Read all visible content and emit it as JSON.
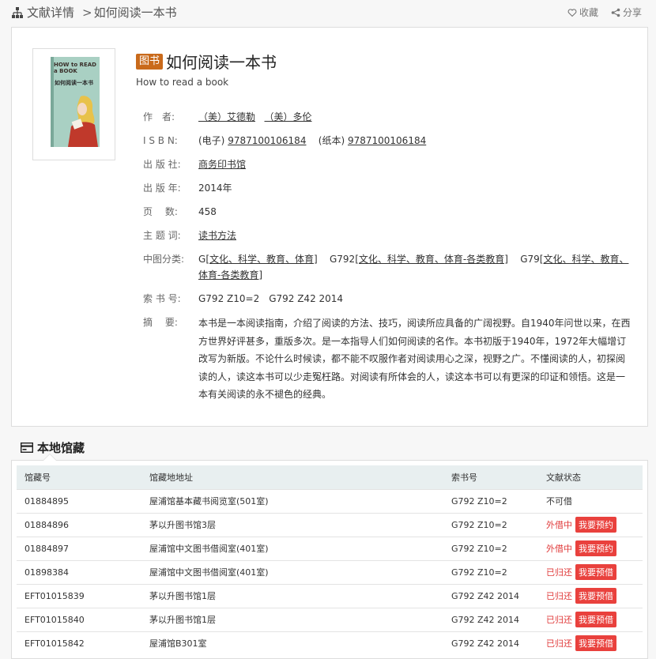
{
  "breadcrumb": {
    "section": "文献详情",
    "separator": ">",
    "current": "如何阅读一本书"
  },
  "actions": {
    "favorite": "收藏",
    "share": "分享"
  },
  "book": {
    "type_badge": "图书",
    "title": "如何阅读一本书",
    "subtitle": "How to read a book",
    "cover": {
      "text_en": "HOW to READ a BOOK",
      "text_cn": "如何阅读一本书"
    },
    "fields": {
      "author_label": "作　者:",
      "authors": [
        "（美）艾德勒",
        "（美）多伦"
      ],
      "isbn_label": "I S B N:",
      "isbn_e_prefix": "(电子)",
      "isbn_e": "9787100106184",
      "isbn_p_prefix": "(纸本)",
      "isbn_p": "9787100106184",
      "publisher_label": "出 版 社:",
      "publisher": "商务印书馆",
      "year_label": "出 版 年:",
      "year": "2014年",
      "pages_label": "页　 数:",
      "pages": "458",
      "subject_label": "主 题 词:",
      "subject": "读书方法",
      "clc_label": "中图分类:",
      "clc_1_code": "G",
      "clc_1_name": "[文化、科学、教育、体育]",
      "clc_2_code": "G792",
      "clc_2_name": "[文化、科学、教育、体育-各类教育]",
      "clc_3_code": "G79",
      "clc_3_name": "[文化、科学、教育、体育-各类教育]",
      "callno_label": "索 书 号:",
      "callno": "G792 Z10=2　G792 Z42 2014",
      "abstract_label": "摘　 要:",
      "abstract": "本书是一本阅读指南，介绍了阅读的方法、技巧，阅读所应具备的广阔视野。自1940年问世以来，在西方世界好评甚多，重版多次。是一本指导人们如何阅读的名作。本书初版于1940年，1972年大幅增订改写为新版。不论什么时候读，都不能不叹服作者对阅读用心之深，视野之广。不懂阅读的人，初探阅读的人，读这本书可以少走冤枉路。对阅读有所体会的人，读这本书可以有更深的印证和领悟。这是一本有关阅读的永不褪色的经典。"
    }
  },
  "holdings": {
    "title": "本地馆藏",
    "columns": [
      "馆藏号",
      "馆藏地地址",
      "索书号",
      "文献状态"
    ],
    "rows": [
      {
        "id": "01884895",
        "location": "屋浦馆基本藏书阅览室(501室)",
        "callno": "G792 Z10=2",
        "status": "不可借",
        "action": ""
      },
      {
        "id": "01884896",
        "location": "茅以升图书馆3层",
        "callno": "G792 Z10=2",
        "status": "外借中",
        "action": "我要预约"
      },
      {
        "id": "01884897",
        "location": "屋浦馆中文图书借阅室(401室)",
        "callno": "G792 Z10=2",
        "status": "外借中",
        "action": "我要预约"
      },
      {
        "id": "01898384",
        "location": "屋浦馆中文图书借阅室(401室)",
        "callno": "G792 Z10=2",
        "status": "已归还",
        "action": "我要预借"
      },
      {
        "id": "EFT01015839",
        "location": "茅以升图书馆1层",
        "callno": "G792 Z42 2014",
        "status": "已归还",
        "action": "我要预借"
      },
      {
        "id": "EFT01015840",
        "location": "茅以升图书馆1层",
        "callno": "G792 Z42 2014",
        "status": "已归还",
        "action": "我要预借"
      },
      {
        "id": "EFT01015842",
        "location": "屋浦馆B301室",
        "callno": "G792 Z42 2014",
        "status": "已归还",
        "action": "我要预借"
      }
    ]
  },
  "colors": {
    "badge": "#c96a1b",
    "status_red": "#e03a3a",
    "button": "#e9413d",
    "table_header": "#e8eff0"
  }
}
